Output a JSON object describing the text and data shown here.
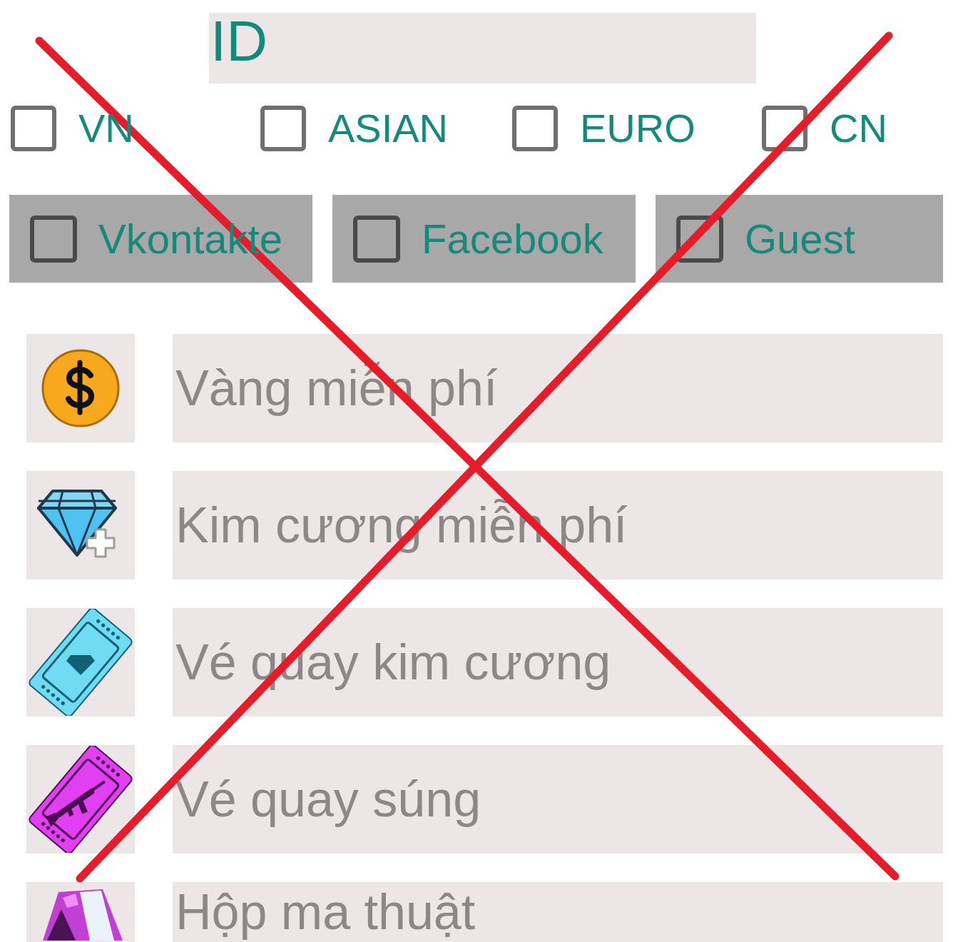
{
  "id_field": {
    "placeholder": "ID"
  },
  "regions": [
    {
      "label": "VN",
      "checked": false
    },
    {
      "label": "ASIAN",
      "checked": false
    },
    {
      "label": "EURO",
      "checked": false
    },
    {
      "label": "CN",
      "checked": false
    }
  ],
  "login_options": [
    {
      "label": "Vkontakte",
      "checked": false
    },
    {
      "label": "Facebook",
      "checked": false
    },
    {
      "label": "Guest",
      "checked": false
    }
  ],
  "items": [
    {
      "kind": "coin",
      "placeholder": "Vàng miễn phí"
    },
    {
      "kind": "diamond",
      "placeholder": "Kim cương miễn phí"
    },
    {
      "kind": "diamond_ticket",
      "placeholder": "Vé quay kim cương"
    },
    {
      "kind": "gun_ticket",
      "placeholder": "Vé quay súng"
    },
    {
      "kind": "magic_box",
      "placeholder": "Hộp ma thuật"
    }
  ]
}
